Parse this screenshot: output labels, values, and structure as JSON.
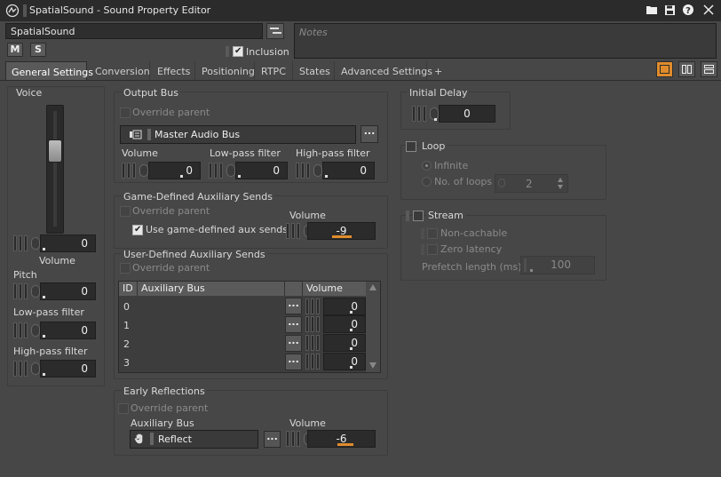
{
  "window": {
    "title": "SpatialSound - Sound Property Editor",
    "buttons": [
      "folder-icon",
      "save-icon",
      "help-icon",
      "close-icon"
    ]
  },
  "object": {
    "name": "SpatialSound",
    "mute_label": "M",
    "solo_label": "S",
    "inclusion_label": "Inclusion",
    "inclusion_checked": true,
    "notes_placeholder": "Notes"
  },
  "tabs": [
    {
      "label": "General Settings",
      "active": true
    },
    {
      "label": "Conversion"
    },
    {
      "label": "Effects"
    },
    {
      "label": "Positioning"
    },
    {
      "label": "RTPC"
    },
    {
      "label": "States"
    },
    {
      "label": "Advanced Settings"
    },
    {
      "label": "+"
    }
  ],
  "voice": {
    "title": "Voice",
    "volume_label": "Volume",
    "volume_value": "0",
    "pitch_label": "Pitch",
    "pitch_value": "0",
    "lowpass_label": "Low-pass filter",
    "lowpass_value": "0",
    "highpass_label": "High-pass filter",
    "highpass_value": "0"
  },
  "output_bus": {
    "title": "Output Bus",
    "override_label": "Override parent",
    "bus_name": "Master Audio Bus",
    "browse_label": "...",
    "volume_label": "Volume",
    "volume_value": "0",
    "lowpass_label": "Low-pass filter",
    "lowpass_value": "0",
    "highpass_label": "High-pass filter",
    "highpass_value": "0"
  },
  "game_aux": {
    "title": "Game-Defined Auxiliary Sends",
    "override_label": "Override parent",
    "use_label": "Use game-defined aux sends",
    "use_checked": true,
    "volume_label": "Volume",
    "volume_value": "-9",
    "volume_fill": 0.55
  },
  "user_aux": {
    "title": "User-Defined Auxiliary Sends",
    "override_label": "Override parent",
    "columns": [
      "ID",
      "Auxiliary Bus",
      "Volume"
    ],
    "rows": [
      {
        "id": "0",
        "bus": "",
        "volume": "0"
      },
      {
        "id": "1",
        "bus": "",
        "volume": "0"
      },
      {
        "id": "2",
        "bus": "",
        "volume": "0"
      },
      {
        "id": "3",
        "bus": "",
        "volume": "0"
      }
    ],
    "browse_label": "..."
  },
  "early_reflections": {
    "title": "Early Reflections",
    "override_label": "Override parent",
    "aux_bus_label": "Auxiliary Bus",
    "aux_bus_value": "Reflect",
    "browse_label": "...",
    "volume_label": "Volume",
    "volume_value": "-6",
    "volume_fill": 0.6
  },
  "initial_delay": {
    "title": "Initial Delay",
    "value": "0"
  },
  "loop": {
    "label": "Loop",
    "checked": false,
    "infinite_label": "Infinite",
    "count_label": "No. of loops",
    "count_value": "2"
  },
  "stream": {
    "label": "Stream",
    "checked": false,
    "noncachable_label": "Non-cachable",
    "zerolatency_label": "Zero latency",
    "prefetch_label": "Prefetch length (ms)",
    "prefetch_value": "100"
  },
  "layout_buttons": [
    "single-pane-icon",
    "two-column-icon",
    "two-row-icon"
  ],
  "colors": {
    "accent": "#e08c2c",
    "background": "#474747",
    "titlebar": "#2b2b2b"
  }
}
